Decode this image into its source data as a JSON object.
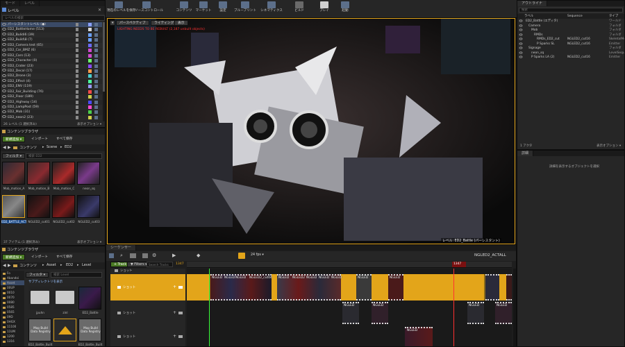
{
  "colors": {
    "accent_orange": "#e3a51a",
    "green_button": "#4a7a24",
    "panel": "#262626",
    "background": "#151515"
  },
  "top_tabs": {
    "mode": "モード",
    "levels": "レベル"
  },
  "levels_panel": {
    "title": "レベル",
    "search_placeholder": "レベルの検索",
    "items": [
      {
        "name": "パーシスタントレベル (●)",
        "color": "#8aa0ff"
      },
      {
        "name": "ED2_BattleHome (513)",
        "color": "#d6d6d6"
      },
      {
        "name": "ED2_Bulidi6 (39)",
        "color": "#6aa0ff"
      },
      {
        "name": "ED2_Build\\8 (7)",
        "color": "#6aa0ff"
      },
      {
        "name": "ED2_Camera test (65)",
        "color": "#6a6aff"
      },
      {
        "name": "ED2_Car_BMZ (6)",
        "color": "#d04ad0"
      },
      {
        "name": "ED2_Cars (13)",
        "color": "#d04ad0"
      },
      {
        "name": "ED2_Character (0)",
        "color": "#6aff6a"
      },
      {
        "name": "ED2_Crater (23)",
        "color": "#8a4aff"
      },
      {
        "name": "ED2_Decal (17)",
        "color": "#ff9a4a"
      },
      {
        "name": "ED2_Drone (3)",
        "color": "#4ad0d0"
      },
      {
        "name": "ED2_Effect (4)",
        "color": "#4aff9a"
      },
      {
        "name": "ED2_ENV (119)",
        "color": "#9a9aff"
      },
      {
        "name": "ED2_Fair_Building (76)",
        "color": "#ff4a4a"
      },
      {
        "name": "ED2_Floor (189)",
        "color": "#d0d04a"
      },
      {
        "name": "ED2_Highway (14)",
        "color": "#4a4aff"
      },
      {
        "name": "ED2_LampPost (59)",
        "color": "#ff4ad0"
      },
      {
        "name": "ED2_Mob (31)",
        "color": "#4ad04a"
      },
      {
        "name": "ED2_neon2 (23)",
        "color": "#d0d04a"
      }
    ],
    "footer_left": "26 レベル (1 選択済み)",
    "footer_right": "表示オプション ▾"
  },
  "content_browser_1": {
    "title": "コンテンツブラウザ",
    "add_new": "新規追加 ▾",
    "import": "インポート",
    "save_all": "すべて保存",
    "path": [
      "コンテンツ",
      "Scene",
      "ED2"
    ],
    "filter": "フィルタ ▾",
    "search_placeholder": "検索 ED2",
    "assets": [
      {
        "name": "Mob_motion_A"
      },
      {
        "name": "Mob_motion_B"
      },
      {
        "name": "Mob_motion_C"
      },
      {
        "name": "neon_sq"
      },
      {
        "name": "ED2_BATTLE_ACTALL"
      },
      {
        "name": "NGLED2_cut01"
      },
      {
        "name": "NGLED2_cut02"
      },
      {
        "name": "NGLED2_cut03"
      }
    ],
    "footer_left": "37 アイテム (1 選択済み)",
    "footer_right": "表示オプション ▾"
  },
  "content_browser_2": {
    "title": "コンテンツブラウザ",
    "add_new": "新規追加 ▾",
    "import": "インポート",
    "save_all": "すべて保存",
    "path": [
      "コンテンツ",
      "Asset",
      "ED2",
      "Level"
    ],
    "filter": "フィルタ ▾",
    "search_placeholder": "検索 Level",
    "notice": "サブディレクトリを表示",
    "tree": [
      "Fo",
      "Abandoi",
      "Asset",
      "00UP",
      "0010",
      "0070",
      "0080",
      "0585",
      "0565",
      "09D",
      "0HGX",
      "11100",
      "11UM",
      "1200",
      "1316"
    ],
    "assets": [
      {
        "name": "jpuhn"
      },
      {
        "name": "zinl"
      },
      {
        "name": "ED2_Battle"
      },
      {
        "name": "ED2_Battle_Built"
      },
      {
        "name": "Map Build Data Registry"
      },
      {
        "name": "ED2_Battle_Built"
      }
    ],
    "thumb_caption": "Map Build Data Registry"
  },
  "toolbar": {
    "buttons": [
      "現在のレベルを保存",
      "ソースコントロール",
      "コンテンツ",
      "マーケット",
      "設定",
      "ブループリント",
      "シネマティクス",
      "ビルド",
      "プレイ",
      "起動"
    ]
  },
  "viewport": {
    "perspective": "パースペクティブ",
    "lighting": "ライティング",
    "show": "表示",
    "warning": "LIGHTING NEEDS TO BE REBUILT (2,187 unbuilt objects)",
    "level_label": "レベル: ED2_Battle (パーシスタント)"
  },
  "outliner": {
    "title": "アウトライナ",
    "search_placeholder": "検索",
    "col_label": "ラベル",
    "col_sequence": "Sequence",
    "col_type": "タイプ",
    "rows": [
      {
        "label": "ED2_Battle (エディタ)",
        "seq": "",
        "type": "ワールド",
        "indent": 0
      },
      {
        "label": "Camera",
        "seq": "",
        "type": "フォルダ",
        "indent": 1
      },
      {
        "label": "Mob",
        "seq": "",
        "type": "フォルダ",
        "indent": 2
      },
      {
        "label": "RMDs",
        "seq": "",
        "type": "フォルダ",
        "indent": 3
      },
      {
        "label": "RMDs_ED2_cut",
        "seq": "NGLED2_cut16",
        "type": "SkeletalMesh",
        "indent": 4
      },
      {
        "label": "P Sparks SL",
        "seq": "NGLED2_cut16",
        "type": "Emitter",
        "indent": 4
      },
      {
        "label": "Signage",
        "seq": "",
        "type": "フォルダ",
        "indent": 1
      },
      {
        "label": "neon_sq",
        "seq": "",
        "type": "LevelSequen",
        "indent": 2
      },
      {
        "label": "P Sparks LA (2)",
        "seq": "NGLED2_cut16",
        "type": "Emitter",
        "indent": 2
      }
    ],
    "footer_left": "1 アクタ",
    "footer_right": "表示オプション ▾"
  },
  "details": {
    "title": "詳細",
    "empty_text": "詳細を表示するオブジェクトを選択"
  },
  "sequencer": {
    "title": "シーケンサー",
    "track_button": "+ Track ▾",
    "filters_button": "▼ Filters ▾",
    "search_placeholder": "Search Tracks",
    "fps": "24 fps ▾",
    "frame_current": "1347",
    "frame_marker": "1347",
    "sequence_name": "NGLED2_ACTALL",
    "tracks": [
      {
        "label": "ショット"
      },
      {
        "label": "ショット"
      },
      {
        "label": "ショット"
      },
      {
        "label": "ショット"
      }
    ],
    "clip_labels": [
      "NGLED",
      "NGLED",
      "NGLED",
      "NGLED2_cut04",
      "NGLED",
      "NGLED2",
      "NGLED",
      "NGLED",
      "NGLED",
      "NGLED",
      "NGLED"
    ],
    "row2_labels": [
      "NGLED",
      "NGLED",
      "NGLED",
      "NGLED"
    ],
    "row3_label": "NGLED"
  }
}
